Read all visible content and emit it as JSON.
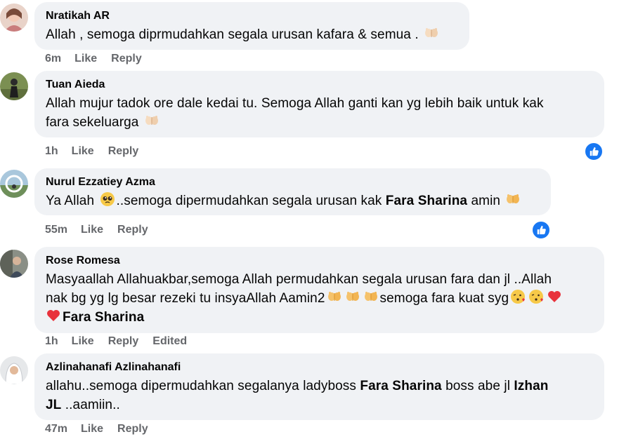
{
  "comments": [
    {
      "author": "Nratikah AR",
      "text_parts": [
        "Allah , semoga diprmudahkan segala urusan kafara & semua ."
      ],
      "time": "6m",
      "like": "Like",
      "reply": "Reply"
    },
    {
      "author": "Tuan Aieda",
      "line1": "Allah mujur tadok ore dale kedai tu. Semoga Allah ganti kan yg lebih baik untuk kak",
      "line2": "fara sekeluarga",
      "time": "1h",
      "like": "Like",
      "reply": "Reply"
    },
    {
      "author": "Nurul Ezzatiey Azma",
      "pre": "Ya Allah",
      "mid": "..semoga dipermudahkan segala urusan kak",
      "mention": "Fara Sharina",
      "post": "amin",
      "time": "55m",
      "like": "Like",
      "reply": "Reply"
    },
    {
      "author": "Rose Romesa",
      "line1": "Masyaallah Allahuakbar,semoga Allah permudahkan segala urusan fara dan jl ..Allah",
      "line2a": "nak bg yg lg besar rezeki tu insyaAllah Aamin2",
      "line2b": "semoga fara kuat syg",
      "mention": "Fara Sharina",
      "time": "1h",
      "like": "Like",
      "reply": "Reply",
      "edited": "Edited"
    },
    {
      "author": "Azlinahanafi Azlinahanafi",
      "pre": "allahu..semoga dipermudahkan segalanya ladyboss",
      "mention1": "Fara Sharina",
      "mid": "boss abe jl",
      "mention2": "Izhan",
      "mention2b": "JL",
      "post": "..aamiin..",
      "time": "47m",
      "like": "Like",
      "reply": "Reply"
    }
  ],
  "colors": {
    "bubble": "#f0f2f5",
    "meta": "#65676b",
    "like_badge": "#1877f2"
  },
  "icons": [
    "praying-hands-icon",
    "pleading-face-icon",
    "kiss-face-icon",
    "red-heart-icon",
    "like-thumb-icon"
  ]
}
